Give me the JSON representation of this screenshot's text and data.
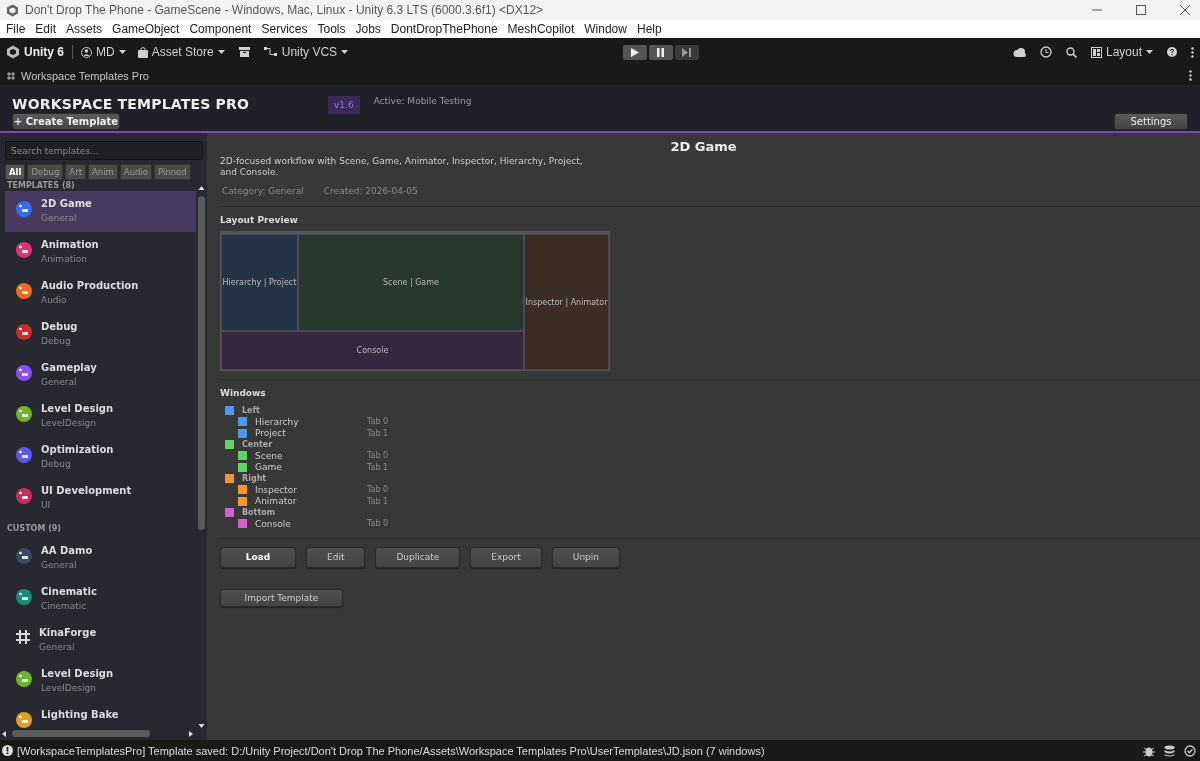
{
  "window": {
    "title": "Don't Drop The Phone - GameScene - Windows, Mac, Linux - Unity 6.3 LTS (6000.3.6f1) <DX12>"
  },
  "menu": [
    "File",
    "Edit",
    "Assets",
    "GameObject",
    "Component",
    "Services",
    "Tools",
    "Jobs",
    "DontDropThePhone",
    "MeshCopilot",
    "Window",
    "Help"
  ],
  "toolbar": {
    "product": "Unity 6",
    "account": "MD",
    "asset_store": "Asset Store",
    "vcs": "Unity VCS",
    "layout": "Layout"
  },
  "editor_tab": "Workspace Templates Pro",
  "header": {
    "title": "WORKSPACE TEMPLATES PRO",
    "version": "v1.6",
    "active": "Active: Mobile Testing",
    "create_button": "+ Create Template",
    "settings_button": "Settings"
  },
  "sidebar": {
    "search": {
      "placeholder": "Search templates..."
    },
    "filters": [
      {
        "label": "All",
        "selected": true
      },
      {
        "label": "Debug",
        "selected": false
      },
      {
        "label": "Art",
        "selected": false
      },
      {
        "label": "Anim",
        "selected": false
      },
      {
        "label": "Audio",
        "selected": false
      },
      {
        "label": "Pinned",
        "selected": false
      }
    ],
    "sections": [
      {
        "title": "TEMPLATES (8)",
        "items": [
          {
            "name": "2D Game",
            "category": "General",
            "kind": "badge",
            "color": "#2f6ff0",
            "selected": true
          },
          {
            "name": "Animation",
            "category": "Animation",
            "kind": "badge",
            "color": "#e0307a",
            "selected": false
          },
          {
            "name": "Audio Production",
            "category": "Audio",
            "kind": "badge",
            "color": "#f06a1a",
            "selected": false
          },
          {
            "name": "Debug",
            "category": "Debug",
            "kind": "badge",
            "color": "#d02a2a",
            "selected": false
          },
          {
            "name": "Gameplay",
            "category": "General",
            "kind": "badge",
            "color": "#8a4ef0",
            "selected": false
          },
          {
            "name": "Level Design",
            "category": "LevelDesign",
            "kind": "badge",
            "color": "#6ab82a",
            "selected": false
          },
          {
            "name": "Optimization",
            "category": "Debug",
            "kind": "badge",
            "color": "#5a5af0",
            "selected": false
          },
          {
            "name": "UI Development",
            "category": "UI",
            "kind": "badge",
            "color": "#d02a60",
            "selected": false
          }
        ]
      },
      {
        "title": "CUSTOM (9)",
        "items": [
          {
            "name": "AA Damo",
            "category": "General",
            "kind": "badge",
            "color": "#3a4a60",
            "selected": false
          },
          {
            "name": "Cinematic",
            "category": "Cinematic",
            "kind": "badge",
            "color": "#1a8a7a",
            "selected": false
          },
          {
            "name": "KinaForge",
            "category": "General",
            "kind": "grid",
            "color": "#d8d8d8",
            "selected": false
          },
          {
            "name": "Level Design",
            "category": "LevelDesign",
            "kind": "badge",
            "color": "#6ab82a",
            "selected": false
          },
          {
            "name": "Lighting Bake",
            "kind": "badge",
            "color": "#e0a020",
            "selected": false
          }
        ]
      }
    ]
  },
  "detail": {
    "title": "2D Game",
    "description": "2D-focused workflow with Scene, Game, Animator, Inspector, Hierarchy, Project, and Console.",
    "category": "Category: General",
    "created": "Created: 2026-04-05",
    "preview_heading": "Layout Preview",
    "preview": [
      {
        "label": "Hierarchy | Project",
        "color": "#253347"
      },
      {
        "label": "Scene | Game",
        "color": "#26392c"
      },
      {
        "label": "Inspector | Animator",
        "color": "#3b2d22"
      },
      {
        "label": "Console",
        "color": "#35273c"
      }
    ],
    "windows_heading": "Windows",
    "windows": [
      {
        "name": "Left",
        "color": "#4a9af5",
        "children": [
          {
            "name": "Hierarchy",
            "tab": "Tab 0",
            "color": "#4a9af5"
          },
          {
            "name": "Project",
            "tab": "Tab 1",
            "color": "#4a9af5"
          }
        ]
      },
      {
        "name": "Center",
        "color": "#5cd65c",
        "children": [
          {
            "name": "Scene",
            "tab": "Tab 0",
            "color": "#5cd65c"
          },
          {
            "name": "Game",
            "tab": "Tab 1",
            "color": "#5cd65c"
          }
        ]
      },
      {
        "name": "Right",
        "color": "#f5962e",
        "children": [
          {
            "name": "Inspector",
            "tab": "Tab 0",
            "color": "#f5962e"
          },
          {
            "name": "Animator",
            "tab": "Tab 1",
            "color": "#f5962e"
          }
        ]
      },
      {
        "name": "Bottom",
        "color": "#d65cd6",
        "children": [
          {
            "name": "Console",
            "tab": "Tab 0",
            "color": "#d65cd6"
          }
        ]
      }
    ],
    "actions": [
      {
        "label": "Load",
        "kind": "primary"
      },
      {
        "label": "Edit",
        "kind": "normal"
      },
      {
        "label": "Duplicate",
        "kind": "normal"
      },
      {
        "label": "Export",
        "kind": "normal"
      },
      {
        "label": "Unpin",
        "kind": "normal"
      }
    ],
    "import_button": "Import Template"
  },
  "status_bar": {
    "message": "[WorkspaceTemplatesPro] Template saved: D:/Unity Project/Don't Drop The Phone/Assets\\Workspace Templates Pro\\UserTemplates\\JD.json (7 windows)"
  }
}
